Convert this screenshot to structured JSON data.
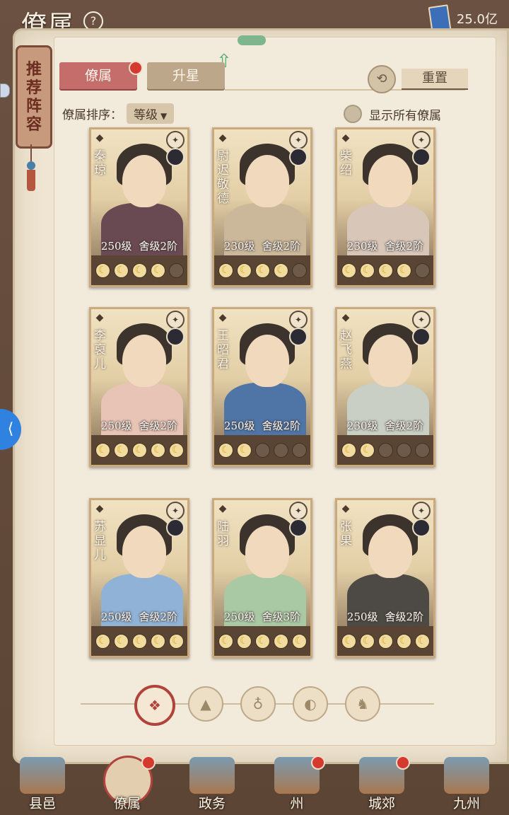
{
  "header": {
    "title": "僚属",
    "help_icon": "question-icon",
    "currency_value": "25.0亿"
  },
  "bookmark": {
    "label_chars": [
      "推",
      "荐",
      "阵",
      "容"
    ]
  },
  "tabs": [
    {
      "label": "僚属",
      "active": true,
      "badge": true
    },
    {
      "label": "升星",
      "active": false
    }
  ],
  "reset": {
    "label": "重置"
  },
  "sort": {
    "label": "僚属排序：",
    "value": "等级"
  },
  "show_all": {
    "label": "显示所有僚属",
    "checked": false
  },
  "cards": [
    {
      "name_chars": [
        "秦",
        "琼"
      ],
      "level": "250级",
      "rank": "舍级2阶",
      "moons_lit": 4,
      "moons_total": 5,
      "outfit": "#6a4a52"
    },
    {
      "name_chars": [
        "尉",
        "迟",
        "敬",
        "德"
      ],
      "level": "230级",
      "rank": "舍级2阶",
      "moons_lit": 4,
      "moons_total": 5,
      "outfit": "#cbb89a"
    },
    {
      "name_chars": [
        "柴",
        "绍"
      ],
      "level": "230级",
      "rank": "舍级2阶",
      "moons_lit": 4,
      "moons_total": 5,
      "outfit": "#d8c6b8"
    },
    {
      "name_chars": [
        "李",
        "裒",
        "儿"
      ],
      "level": "250级",
      "rank": "舍级2阶",
      "moons_lit": 5,
      "moons_total": 5,
      "outfit": "#e8c4b6"
    },
    {
      "name_chars": [
        "王",
        "昭",
        "君"
      ],
      "level": "250级",
      "rank": "舍级2阶",
      "moons_lit": 2,
      "moons_total": 5,
      "outfit": "#4f74a6"
    },
    {
      "name_chars": [
        "赵",
        "飞",
        "燕"
      ],
      "level": "230级",
      "rank": "舍级2阶",
      "moons_lit": 2,
      "moons_total": 5,
      "outfit": "#c9cfc4"
    },
    {
      "name_chars": [
        "苏",
        "显",
        "儿"
      ],
      "level": "250级",
      "rank": "舍级2阶",
      "moons_lit": 5,
      "moons_total": 5,
      "outfit": "#8fb2d6"
    },
    {
      "name_chars": [
        "陆",
        "羽"
      ],
      "level": "250级",
      "rank": "舍级3阶",
      "moons_lit": 5,
      "moons_total": 5,
      "outfit": "#a9c8a4"
    },
    {
      "name_chars": [
        "张",
        "果"
      ],
      "level": "250级",
      "rank": "舍级2阶",
      "moons_lit": 5,
      "moons_total": 5,
      "outfit": "#4d4a45"
    }
  ],
  "filters": [
    {
      "icon": "diamond-grid-icon",
      "glyph": "❖",
      "active": true
    },
    {
      "icon": "mountain-icon",
      "glyph": "▲",
      "active": false
    },
    {
      "icon": "gourd-icon",
      "glyph": "♁",
      "active": false
    },
    {
      "icon": "fan-icon",
      "glyph": "◐",
      "active": false
    },
    {
      "icon": "beast-icon",
      "glyph": "♞",
      "active": false
    }
  ],
  "nav": [
    {
      "label": "县邑",
      "badge": false,
      "active": false
    },
    {
      "label": "僚属",
      "badge": true,
      "active": true
    },
    {
      "label": "政务",
      "badge": false,
      "active": false
    },
    {
      "label": "州",
      "badge": true,
      "active": false
    },
    {
      "label": "城郊",
      "badge": true,
      "active": false
    },
    {
      "label": "九州",
      "badge": false,
      "active": false
    }
  ],
  "colors": {
    "accent_red": "#b0433c",
    "tab_active": "#c46d6a",
    "moon_lit": "#f1dc9e"
  }
}
